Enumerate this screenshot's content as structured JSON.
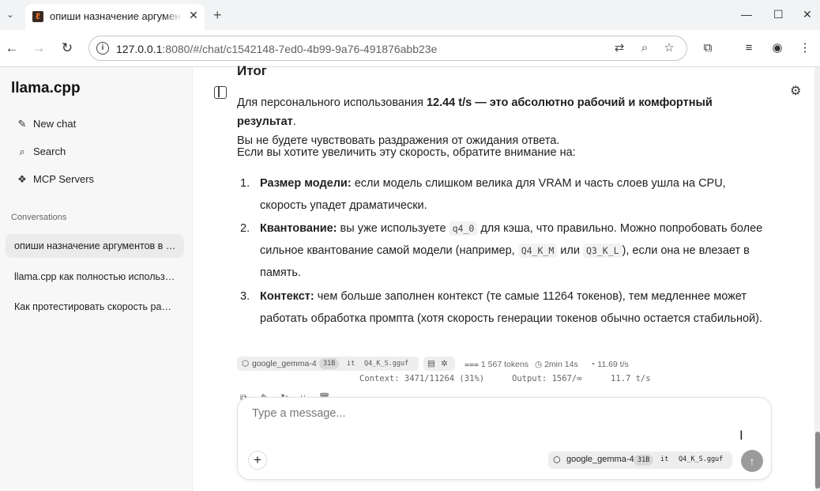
{
  "browser": {
    "tab_title": "опиши назначение аргументов",
    "url_host": "127.0.0.1",
    "url_rest": ":8080/#/chat/c1542148-7ed0-4b99-9a76-491876abb23e"
  },
  "sidebar": {
    "brand": "llama.cpp",
    "items": [
      {
        "label": "New chat",
        "icon": "edit-icon"
      },
      {
        "label": "Search",
        "icon": "search-icon"
      },
      {
        "label": "MCP Servers",
        "icon": "mcp-icon"
      }
    ],
    "conversations_title": "Conversations",
    "conversations": [
      "опиши назначение аргументов в …",
      "llama.cpp как полностью использ…",
      "Как протестировать скорость раб…"
    ]
  },
  "message": {
    "heading": "Итог",
    "p1_a": "Для персонального использования ",
    "p1_bold": "12.44 t/s — это абсолютно рабочий и комфортный результат",
    "p1_b": ".",
    "p1_line2": "Вы не будете чувствовать раздражения от ожидания ответа.",
    "p2": "Если вы хотите увеличить эту скорость, обратите внимание на:",
    "list": [
      {
        "num": "1.",
        "bold": "Размер модели:",
        "text": " если модель слишком велика для VRAM и часть слоев ушла на CPU, скорость упадет драматически."
      },
      {
        "num": "2.",
        "bold": "Квантование:",
        "text_a": " вы уже используете ",
        "code_a": "q4_0",
        "text_b": " для кэша, что правильно. Можно попробовать более сильное квантование самой модели (например, ",
        "code_b": "Q4_K_M",
        "text_c": " или ",
        "code_c": "Q3_K_L",
        "text_d": "), если она не влезает в память."
      },
      {
        "num": "3.",
        "bold": "Контекст:",
        "text": " чем больше заполнен контекст (те самые 11264 токенов), тем медленнее может работать обработка промпта (хотя скорость генерации токенов обычно остается стабильной)."
      }
    ]
  },
  "meta": {
    "model_name": "google_gemma-4",
    "model_size": "31B",
    "model_variant": "it",
    "model_file": "Q4_K_S.gguf",
    "tokens": "1 567 tokens",
    "time": "2min 14s",
    "speed": "11.69 t/s",
    "context": "Context: 3471/11264 (31%)",
    "output": "Output: 1567/∞",
    "rate": "11.7 t/s"
  },
  "composer": {
    "placeholder": "Type a message...",
    "model_name": "google_gemma-4",
    "model_size": "31B",
    "model_variant": "it",
    "model_file": "Q4_K_S.gguf"
  }
}
